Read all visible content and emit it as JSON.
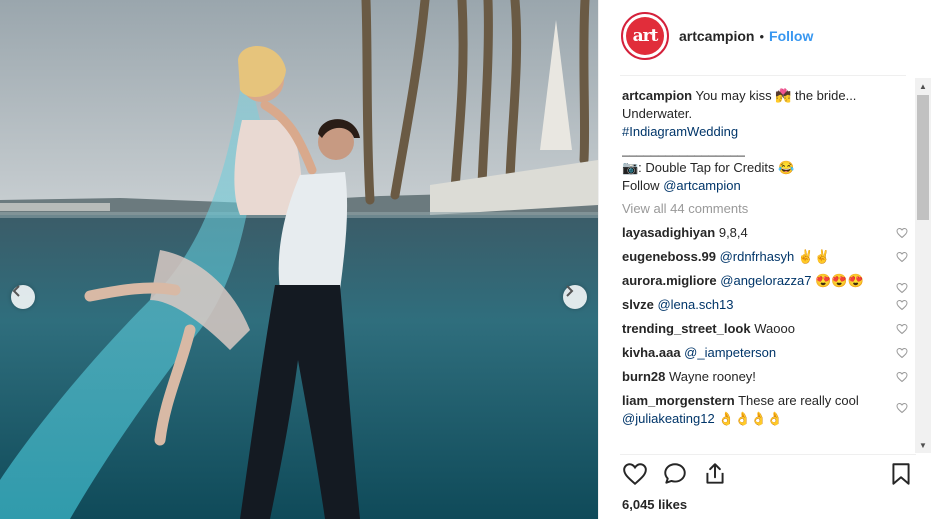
{
  "post": {
    "username": "artcampion",
    "follow_label": "Follow",
    "separator": "•",
    "avatar_text": "art",
    "brand_color": "#e12d3a"
  },
  "caption": {
    "username": "artcampion",
    "line1": "You may kiss 💏 the bride...",
    "line2": "Underwater.",
    "hashtag": "#IndiagramWedding",
    "rule": "_________________",
    "credits": "📷: Double Tap for Credits 😂",
    "follow_text": "Follow",
    "follow_mention": "@artcampion"
  },
  "view_all": "View all 44 comments",
  "comments": [
    {
      "user": "layasadighiyan",
      "text": "9,8,4",
      "mention": ""
    },
    {
      "user": "eugeneboss.99",
      "text": "✌✌",
      "mention": "@rdnfrhasyh"
    },
    {
      "user": "aurora.migliore",
      "text": "😍😍😍",
      "mention": "@angelorazza7"
    },
    {
      "user": "slvze",
      "text": "",
      "mention": "@lena.sch13"
    },
    {
      "user": "trending_street_look",
      "text": "Waooo",
      "mention": ""
    },
    {
      "user": "kivha.aaa",
      "text": "",
      "mention": "@_iampeterson"
    },
    {
      "user": "burn28",
      "text": "Wayne rooney!",
      "mention": ""
    },
    {
      "user": "liam_morgenstern",
      "text": "These are really cool",
      "mention": "@juliakeating12",
      "suffix": "👌👌👌👌"
    }
  ],
  "likes": "6,045 likes",
  "icons": {
    "like": "heart-icon",
    "comment": "comment-icon",
    "share": "share-icon",
    "save": "bookmark-icon",
    "prev": "chevron-left-icon",
    "next": "chevron-right-icon"
  },
  "colors": {
    "link": "#3897f0",
    "mention": "#003569",
    "muted": "#999999"
  }
}
